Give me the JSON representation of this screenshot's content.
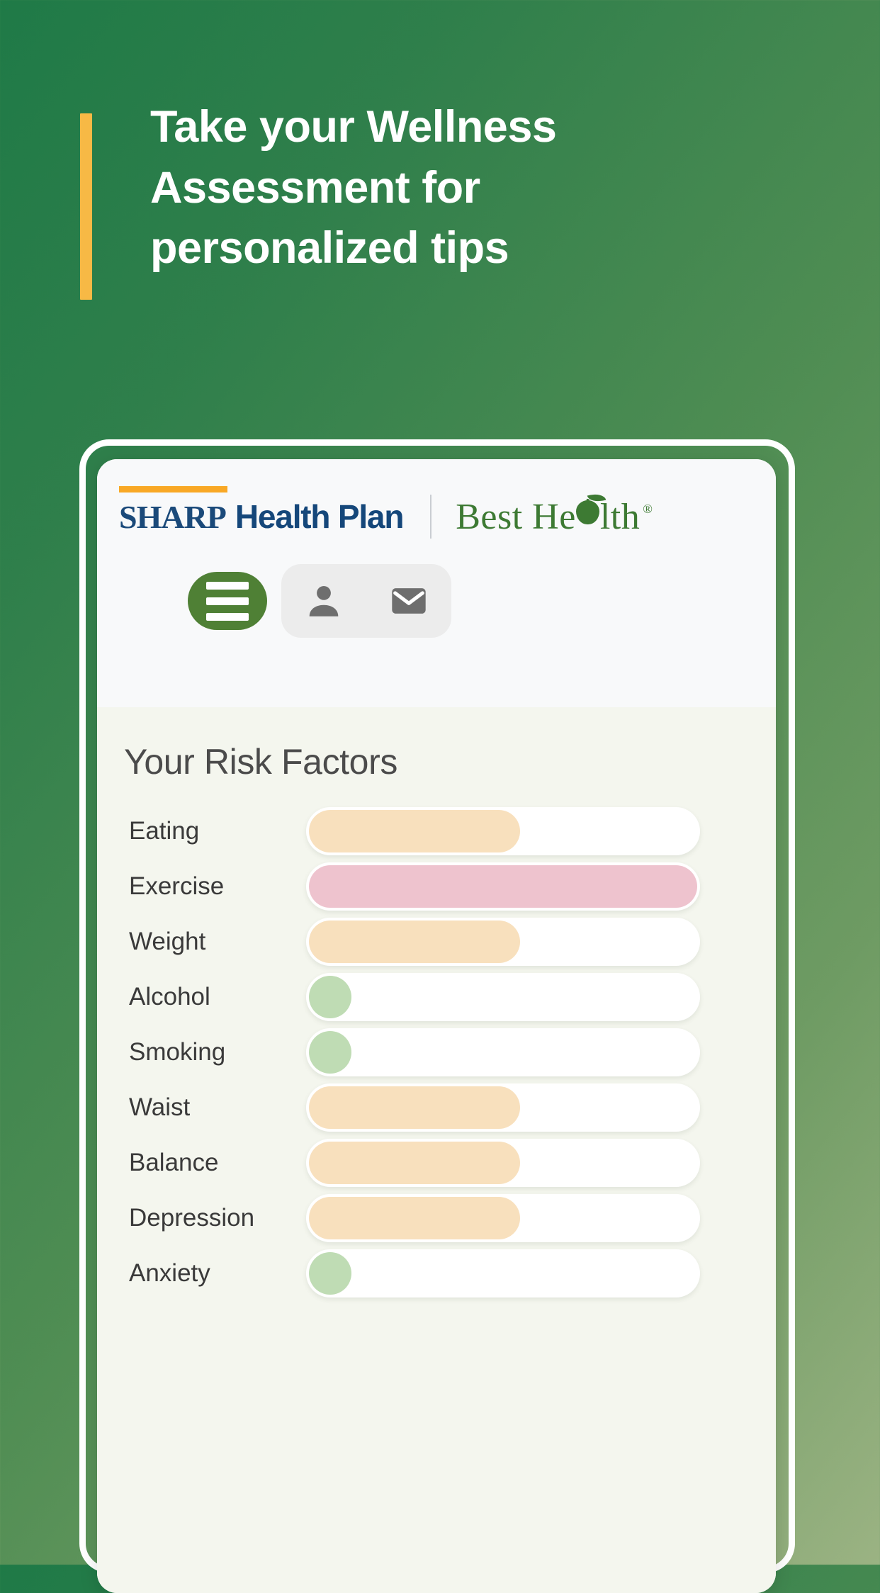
{
  "hero": {
    "title": "Take your Wellness Assessment for personalized tips",
    "accent_bar_color": "#f7b945",
    "text_color": "#ffffff",
    "background_gradient_from": "#1f7a47",
    "background_gradient_to": "#9bb383"
  },
  "app": {
    "brand": {
      "sharp_word": "SHARP",
      "sharp_rest": "Health Plan",
      "sharp_color": "#15477a",
      "sharp_rule_color": "#f9a825",
      "best_health_pre": "Best He",
      "best_health_post": "lth",
      "registered_mark": "®",
      "best_health_color": "#3d7a33"
    },
    "nav": {
      "menu_label": "Menu",
      "account_label": "Account",
      "messages_label": "Messages",
      "menu_button_color": "#4f8035",
      "icon_pill_color": "#ececec"
    },
    "panel": {
      "title": "Your Risk Factors"
    }
  },
  "chart_data": {
    "type": "bar",
    "title": "Your Risk Factors",
    "orientation": "horizontal",
    "xlabel": "",
    "ylabel": "",
    "xlim": [
      0,
      100
    ],
    "grid": false,
    "legend": "none",
    "categories": [
      "Eating",
      "Exercise",
      "Weight",
      "Alcohol",
      "Smoking",
      "Waist",
      "Balance",
      "Depression",
      "Anxiety"
    ],
    "values": [
      55,
      100,
      55,
      10,
      10,
      55,
      55,
      55,
      10
    ],
    "colors": [
      "#f8e0bd",
      "#eec3ce",
      "#f8e0bd",
      "#bfdcb4",
      "#bfdcb4",
      "#f8e0bd",
      "#f8e0bd",
      "#f8e0bd",
      "#bfdcb4"
    ],
    "risk_level_colors": {
      "low": "#bfdcb4",
      "moderate": "#f8e0bd",
      "high": "#eec3ce"
    },
    "track_color": "#ffffff",
    "items": [
      {
        "label": "Eating",
        "value": 55,
        "color": "#f8e0bd",
        "level": "moderate"
      },
      {
        "label": "Exercise",
        "value": 100,
        "color": "#eec3ce",
        "level": "high"
      },
      {
        "label": "Weight",
        "value": 55,
        "color": "#f8e0bd",
        "level": "moderate"
      },
      {
        "label": "Alcohol",
        "value": 10,
        "color": "#bfdcb4",
        "level": "low"
      },
      {
        "label": "Smoking",
        "value": 10,
        "color": "#bfdcb4",
        "level": "low"
      },
      {
        "label": "Waist",
        "value": 55,
        "color": "#f8e0bd",
        "level": "moderate"
      },
      {
        "label": "Balance",
        "value": 55,
        "color": "#f8e0bd",
        "level": "moderate"
      },
      {
        "label": "Depression",
        "value": 55,
        "color": "#f8e0bd",
        "level": "moderate"
      },
      {
        "label": "Anxiety",
        "value": 10,
        "color": "#bfdcb4",
        "level": "low"
      }
    ]
  }
}
